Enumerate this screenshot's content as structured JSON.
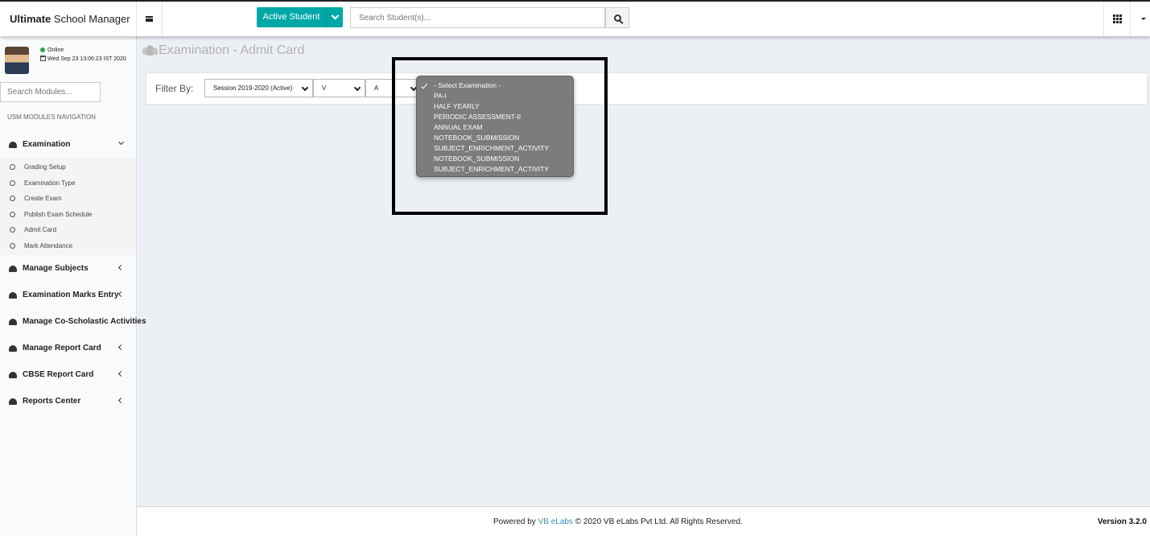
{
  "brand": {
    "bold": "Ultimate",
    "rest": " School Manager"
  },
  "header": {
    "active_student_label": "Active Student",
    "search_placeholder": "Search Student(s)..."
  },
  "user": {
    "status": "Online",
    "datetime": "Wed Sep 23 13:06:23 IST 2020"
  },
  "sidebar": {
    "search_placeholder": "Search Modules...",
    "nav_header": "USM MODULES NAVIGATION",
    "items": [
      {
        "label": "Examination",
        "expanded": true,
        "children": [
          "Grading Setup",
          "Examination Type",
          "Create Exam",
          "Publish Exam Schedule",
          "Admit Card",
          "Mark Attendance"
        ]
      },
      {
        "label": "Manage Subjects"
      },
      {
        "label": "Examination Marks Entry"
      },
      {
        "label": "Manage Co-Scholastic Activities"
      },
      {
        "label": "Manage Report Card"
      },
      {
        "label": "CBSE Report Card"
      },
      {
        "label": "Reports Center"
      }
    ]
  },
  "page": {
    "title": "Examination - Admit Card"
  },
  "filter": {
    "label": "Filter By:",
    "session": "Session 2019-2020 (Active)",
    "class": "V",
    "section": "A"
  },
  "exam_dropdown": {
    "selected": "- Select Examination -",
    "options": [
      "- Select Examination -",
      "PA-I",
      "HALF YEARLY",
      "PERIODIC ASSESSMENT-II",
      "ANNUAL EXAM",
      "NOTEBOOK_SUBMISSION",
      "SUBJECT_ENRICHMENT_ACTIVITY",
      "NOTEBOOK_SUBMISSION",
      "SUBJECT_ENRICHMENT_ACTIVITY"
    ]
  },
  "footer": {
    "powered_by": "Powered by",
    "company_link": "VB eLabs",
    "copyright": "© 2020 VB eLabs Pvt Ltd. All Rights Reserved.",
    "version": "Version 3.2.0"
  },
  "colors": {
    "accent": "#00a7a7",
    "link": "#3c8dbc",
    "online": "#27a845",
    "background": "#ecf0f5"
  }
}
